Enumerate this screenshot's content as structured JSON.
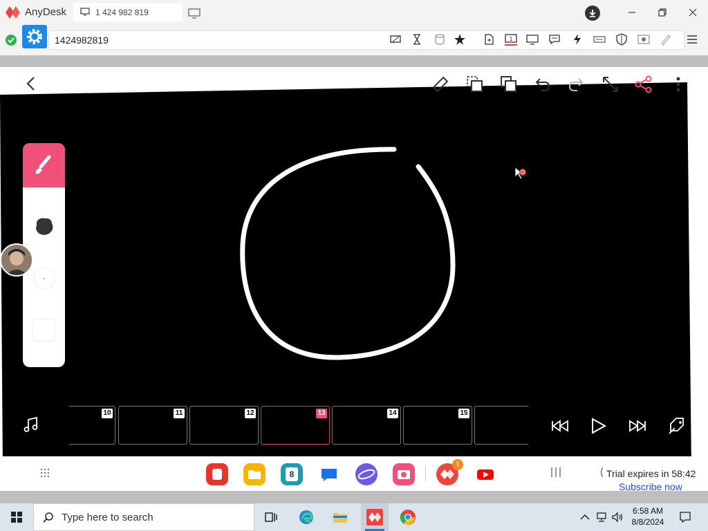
{
  "anydesk": {
    "app_name": "AnyDesk",
    "tab_label": "1 424 982 819",
    "address_value": "1424982819"
  },
  "remote": {
    "timeline_frames": [
      {
        "num": "10",
        "active": false
      },
      {
        "num": "11",
        "active": false
      },
      {
        "num": "12",
        "active": false
      },
      {
        "num": "13",
        "active": true
      },
      {
        "num": "14",
        "active": false
      },
      {
        "num": "15",
        "active": false
      },
      {
        "num": "",
        "active": false
      }
    ],
    "dock_notification_badge": "1",
    "calendar_day": "8",
    "trial_text": "Trial expires in 58:42",
    "subscribe_link": "Subscribe now"
  },
  "taskbar": {
    "search_placeholder": "Type here to search",
    "time": "6:58 AM",
    "date": "8/8/2024"
  },
  "colors": {
    "accent_pink": "#f0507a",
    "anydesk_red": "#ef443b",
    "settings_blue": "#1e88e5",
    "status_green": "#2db34a"
  }
}
